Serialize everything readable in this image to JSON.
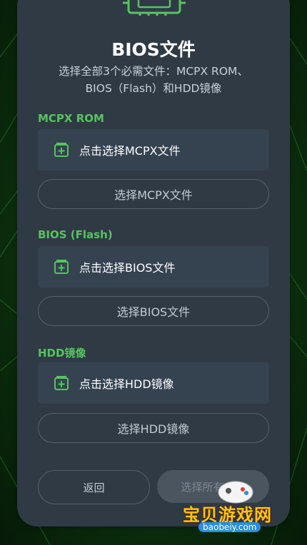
{
  "header": {
    "title": "BIOS文件",
    "subtitle_line1": "选择全部3个必需文件：MCPX ROM、",
    "subtitle_line2": "BIOS（Flash）和HDD镜像"
  },
  "sections": [
    {
      "label": "MCPX ROM",
      "picker_text": "点击选择MCPX文件",
      "button_label": "选择MCPX文件"
    },
    {
      "label": "BIOS (Flash)",
      "picker_text": "点击选择BIOS文件",
      "button_label": "选择BIOS文件"
    },
    {
      "label": "HDD镜像",
      "picker_text": "点击选择HDD镜像",
      "button_label": "选择HDD镜像"
    }
  ],
  "footer": {
    "back_label": "返回",
    "select_all_label": "选择所有文件"
  },
  "watermark": {
    "title": "宝贝游戏网",
    "url": "baobeiy.com"
  },
  "colors": {
    "accent": "#57c35f",
    "card": "#2f3a45",
    "picker": "#354250"
  },
  "icons": {
    "chip": "chip-icon",
    "add_file": "add-file-icon"
  }
}
